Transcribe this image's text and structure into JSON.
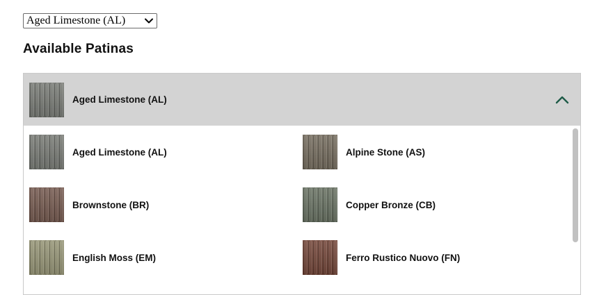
{
  "select": {
    "value": "Aged Limestone (AL)",
    "icon": "chevron-down-icon"
  },
  "section_title": "Available Patinas",
  "panel": {
    "selected": {
      "label": "Aged Limestone (AL)",
      "swatch_color": "#6f726c",
      "icon": "chevron-up-icon"
    },
    "items": [
      {
        "label": "Aged Limestone (AL)",
        "swatch_color": "#6f726c"
      },
      {
        "label": "Alpine Stone (AS)",
        "swatch_color": "#6c6354"
      },
      {
        "label": "Brownstone (BR)",
        "swatch_color": "#6c4f44"
      },
      {
        "label": "Copper Bronze (CB)",
        "swatch_color": "#5f6959"
      },
      {
        "label": "English Moss (EM)",
        "swatch_color": "#8f8e6d"
      },
      {
        "label": "Ferro Rustico Nuovo (FN)",
        "swatch_color": "#6a3a2c"
      }
    ]
  },
  "colors": {
    "header_bg": "#d3d3d3",
    "chevron_color": "#1e5b47"
  }
}
